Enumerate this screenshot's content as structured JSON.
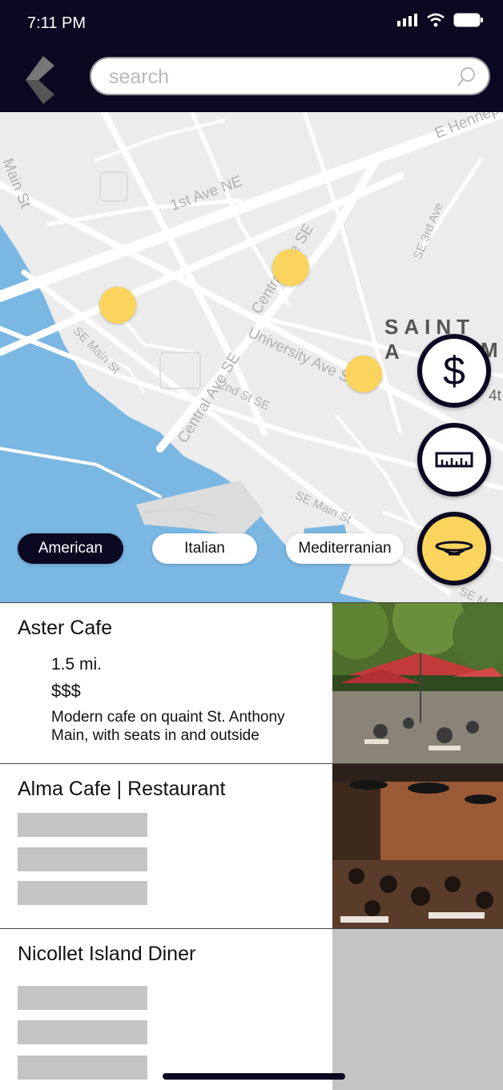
{
  "status_bar": {
    "time": "7:11 PM"
  },
  "header": {
    "search_placeholder": "search"
  },
  "map": {
    "streets": [
      "1st Ave NE",
      "E Hennepin",
      "Main St",
      "Central Ave SE",
      "SE 3rd Ave",
      "University Ave SE",
      "SE Main St",
      "Central Ave SE",
      "2nd St SE",
      "SE Main St",
      "SE M"
    ],
    "district_line1": "SAINT A",
    "district_line2": "M",
    "partial_label": "4t",
    "price_filter": "$"
  },
  "cuisine_chips": [
    "American",
    "Italian",
    "Mediterranian"
  ],
  "colors": {
    "navy": "#0b0821",
    "pin_yellow": "#fad45c",
    "water": "#7ab7e3",
    "map_bg": "#ececec"
  },
  "listings": [
    {
      "name": "Aster Cafe",
      "distance": "1.5 mi.",
      "price": "$$$",
      "description": "Modern cafe on quaint St. Anthony Main, with seats in and outside"
    },
    {
      "name": "Alma Cafe | Restaurant"
    },
    {
      "name": "Nicollet Island Diner"
    }
  ],
  "icons": [
    "back-chevron-icon",
    "search-icon",
    "signal-icon",
    "wifi-icon",
    "battery-icon",
    "dollar-icon",
    "ruler-icon",
    "dish-icon"
  ]
}
